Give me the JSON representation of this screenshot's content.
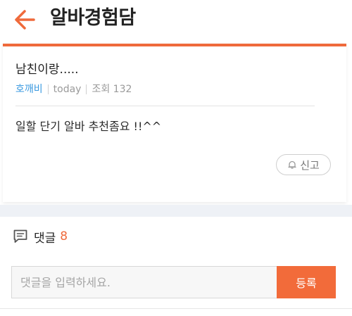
{
  "header": {
    "title": "알바경험담",
    "back_icon": "arrow-left-icon",
    "accent_color": "#ef6a3b"
  },
  "post": {
    "title": "남친이랑.....",
    "author": "호깨비",
    "date": "today",
    "views": "조회 132",
    "body": "일할 단기 알바 추천좀요 !!^^",
    "report_label": "신고",
    "report_icon": "bell-icon"
  },
  "comments": {
    "label": "댓글",
    "count": "8",
    "icon": "comment-icon",
    "input_placeholder": "댓글을 입력하세요.",
    "submit_label": "등록"
  }
}
